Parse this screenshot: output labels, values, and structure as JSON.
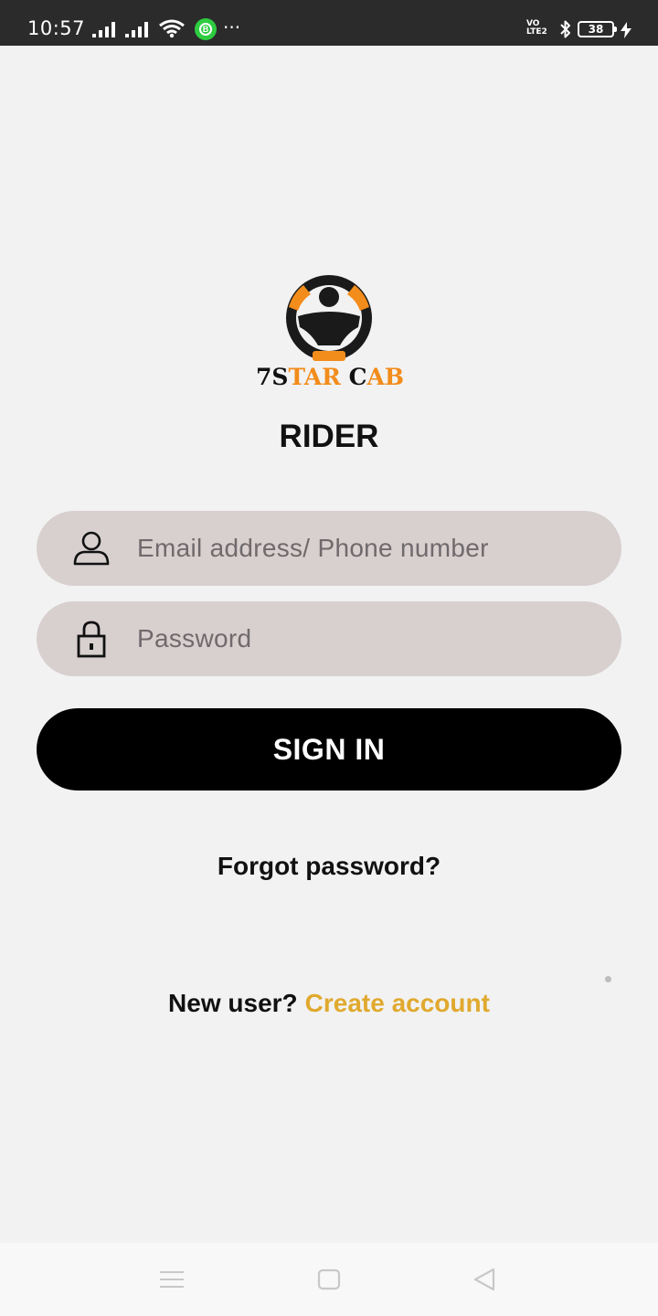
{
  "status_bar": {
    "time": "10:57",
    "app_badge": "B",
    "more": "···",
    "network_label_top": "VO",
    "network_label_bottom": "LTE2",
    "battery_level": "38"
  },
  "logo": {
    "brand_part1": "7S",
    "brand_part2": "TAR",
    "brand_part3": " C",
    "brand_part4": "AB",
    "colors": {
      "dark": "#111111",
      "orange": "#f28c1b"
    },
    "icon": "steering-wheel-icon"
  },
  "page_title": "RIDER",
  "form": {
    "email_placeholder": "Email address/ Phone number",
    "email_icon": "user-icon",
    "password_placeholder": "Password",
    "password_icon": "lock-icon",
    "signin_label": "SIGN IN",
    "forgot_label": "Forgot password?"
  },
  "signup": {
    "prompt": "New user?",
    "link": "Create account",
    "link_color": "#e0a92e"
  },
  "nav_bar": {
    "menu_icon": "menu-icon",
    "home_icon": "square-home-icon",
    "back_icon": "triangle-back-icon"
  }
}
